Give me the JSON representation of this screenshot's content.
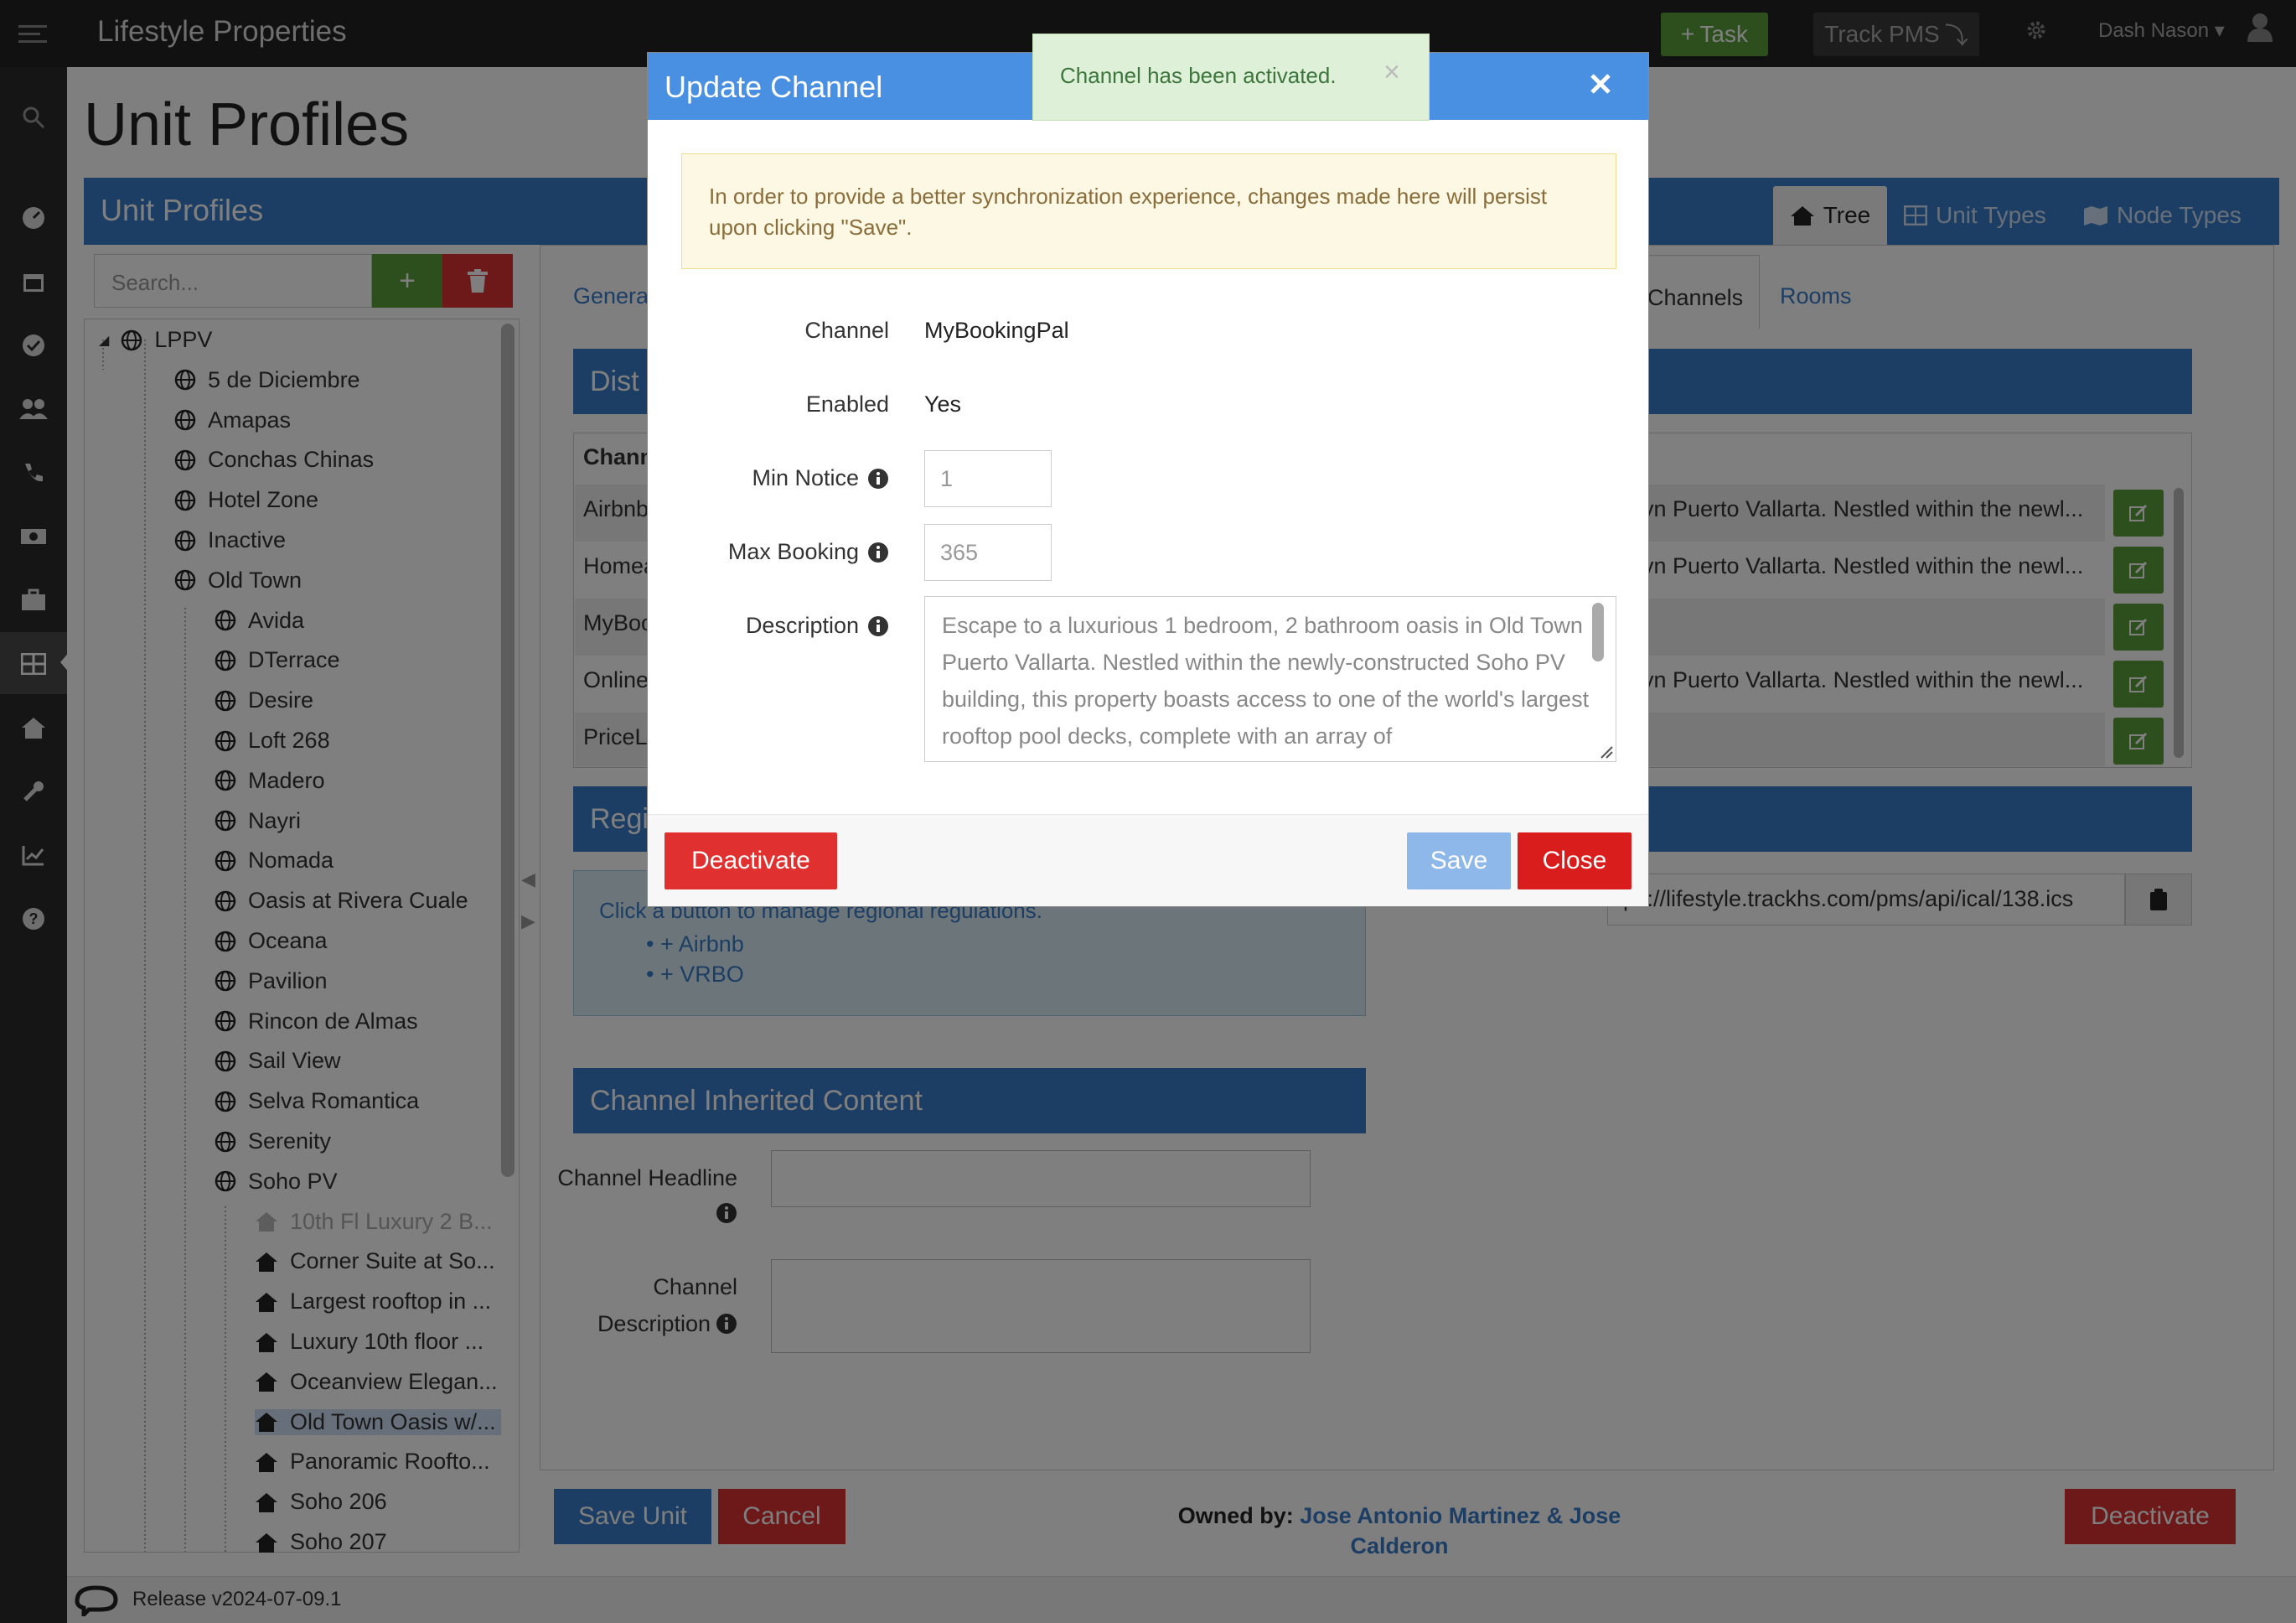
{
  "app": {
    "title": "Lifestyle Properties",
    "task_label": "Task",
    "pms_label": "Track PMS",
    "user_name": "Dash Nason"
  },
  "page": {
    "title": "Unit Profiles",
    "panel_title": "Unit Profiles"
  },
  "header_tabs": [
    {
      "label": "Tree"
    },
    {
      "label": "Unit Types"
    },
    {
      "label": "Node Types"
    }
  ],
  "tree": {
    "search_placeholder": "Search...",
    "root": "LPPV",
    "nodes": [
      "5 de Diciembre",
      "Amapas",
      "Conchas Chinas",
      "Hotel Zone",
      "Inactive",
      "Old Town"
    ],
    "old_town_children": [
      "Avida",
      "DTerrace",
      "Desire",
      "Loft 268",
      "Madero",
      "Nayri",
      "Nomada",
      "Oasis at Rivera Cuale",
      "Oceana",
      "Pavilion",
      "Rincon de Almas",
      "Sail View",
      "Selva Romantica",
      "Serenity",
      "Soho PV"
    ],
    "soho_units": [
      "10th Fl Luxury 2 B...",
      "Corner Suite at So...",
      "Largest rooftop in ...",
      "Luxury 10th floor ...",
      "Oceanview Elegan...",
      "Old Town Oasis w/...",
      "Panoramic Roofto...",
      "Soho 206",
      "Soho 207"
    ]
  },
  "content": {
    "tabs": {
      "general": "Genera",
      "channels": "Channels",
      "rooms": "Rooms"
    },
    "dist_header": "Dist",
    "table_col": "Chann",
    "rows": [
      {
        "name": "Airbnb",
        "desc": "vn Puerto Vallarta. Nestled within the newl..."
      },
      {
        "name": "Homea",
        "desc": "vn Puerto Vallarta. Nestled within the newl..."
      },
      {
        "name": "MyBoo",
        "desc": ""
      },
      {
        "name": "Online",
        "desc": "vn Puerto Vallarta. Nestled within the newl..."
      },
      {
        "name": "PriceL",
        "desc": ""
      }
    ],
    "reg_header": "Regi",
    "reg_text": "Click a button to manage regional regulations.",
    "reg_links": [
      "Airbnb",
      "VRBO"
    ],
    "ical": "ps://lifestyle.trackhs.com/pms/api/ical/138.ics",
    "inherited_header": "Channel Inherited Content",
    "headline_label": "Channel Headline",
    "desc_label_1": "Channel",
    "desc_label_2": "Description",
    "save_unit": "Save Unit",
    "cancel": "Cancel",
    "deactivate": "Deactivate",
    "owned_label": "Owned by:",
    "owner_1": "Jose Antonio Martinez & Jose",
    "owner_2": "Calderon"
  },
  "footer": {
    "release": "Release v2024-07-09.1"
  },
  "modal": {
    "title": "Update Channel",
    "warning": "In order to provide a better synchronization experience, changes made here will persist upon clicking \"Save\".",
    "channel_label": "Channel",
    "channel_value": "MyBookingPal",
    "enabled_label": "Enabled",
    "enabled_value": "Yes",
    "min_notice_label": "Min Notice",
    "min_notice_value": "1",
    "max_booking_label": "Max Booking",
    "max_booking_value": "365",
    "description_label": "Description",
    "description_value": "Escape to a luxurious 1 bedroom, 2 bathroom oasis in Old Town Puerto Vallarta. Nestled within the newly-constructed Soho PV building, this property boasts access to one of the world's largest rooftop pool decks, complete with an array of",
    "deactivate": "Deactivate",
    "save": "Save",
    "close": "Close"
  },
  "toast": {
    "message": "Channel has been activated."
  },
  "colors": {
    "primary": "#3b7dc9",
    "success": "#5a9e3a",
    "danger": "#d33",
    "modal_header": "#4a90e2"
  }
}
